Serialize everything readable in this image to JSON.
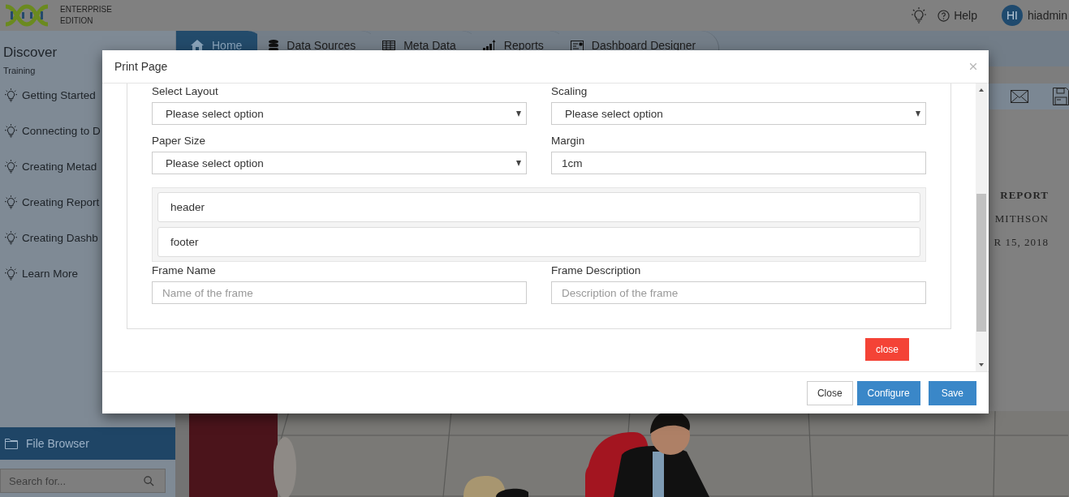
{
  "header": {
    "edition": [
      "ENTERPRISE",
      "EDITION"
    ],
    "help": "Help",
    "avatar": "HI",
    "user": "hiadmin"
  },
  "sidebar": {
    "title": "Discover",
    "subtitle": "Training",
    "items": [
      "Getting Started",
      "Connecting to D",
      "Creating Metad",
      "Creating Report",
      "Creating Dashb",
      "Learn More"
    ],
    "file_browser": "File Browser",
    "search": {
      "placeholder": "Search for..."
    }
  },
  "tabs": [
    {
      "label": "Home",
      "selected": true
    },
    {
      "label": "Data Sources",
      "selected": false
    },
    {
      "label": "Meta Data",
      "selected": false
    },
    {
      "label": "Reports",
      "selected": false
    },
    {
      "label": "Dashboard Designer",
      "selected": false
    }
  ],
  "report": [
    "REPORT",
    "MITHSON",
    "R 15, 2018"
  ],
  "dialog": {
    "title": "Print Page",
    "fields": [
      {
        "label": "Select Layout",
        "kind": "select",
        "value": "Please select option"
      },
      {
        "label": "Scaling",
        "kind": "select",
        "value": "Please select option"
      },
      {
        "label": "Paper Size",
        "kind": "select",
        "value": "Please select option"
      },
      {
        "label": "Margin",
        "kind": "input",
        "value": "1cm"
      }
    ],
    "sections": [
      "header",
      "footer"
    ],
    "frame_fields": [
      {
        "label": "Frame Name",
        "kind": "input",
        "placeholder": "Name of the frame"
      },
      {
        "label": "Frame Description",
        "kind": "input",
        "placeholder": "Description of the frame"
      }
    ],
    "remove_button": "close",
    "buttons": [
      {
        "label": "Close",
        "kind": "default"
      },
      {
        "label": "Configure",
        "kind": "primary"
      },
      {
        "label": "Save",
        "kind": "primary"
      }
    ]
  }
}
